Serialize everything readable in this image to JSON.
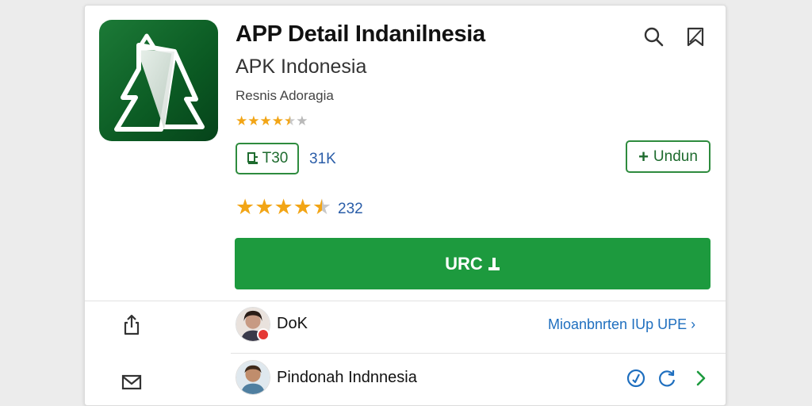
{
  "app": {
    "title": "APP Detail Indanilnesia",
    "subtitle": "APK Indonesia",
    "developer": "Resnis Adoragia",
    "icon": "app-logo-icon"
  },
  "header": {
    "search_icon": "search-icon",
    "bookmark_icon": "bookmark-icon"
  },
  "rating_small": {
    "value": 4.5,
    "max": 5
  },
  "size_chip": {
    "label": "T30",
    "icon": "download-file-icon"
  },
  "size_count": "31K",
  "undun_button": {
    "label": "Undun",
    "icon": "plus-icon"
  },
  "rating_big": {
    "value": 4.5,
    "max": 5,
    "count": "232"
  },
  "install_button": {
    "label": "URC",
    "icon": "download-icon"
  },
  "rows": [
    {
      "name": "DoK",
      "link": "Mioanbnrten IUp UPE",
      "link_arrow": "›",
      "side_icon": "share-icon"
    },
    {
      "name": "Pindonah Indnnesia",
      "side_icon": "mail-icon",
      "actions": [
        "check-circle-icon",
        "refresh-icon",
        "chevron-right-icon"
      ]
    }
  ],
  "colors": {
    "accent_green": "#1d9a3e",
    "link_blue": "#1f6fbf",
    "star": "#f2a516"
  }
}
